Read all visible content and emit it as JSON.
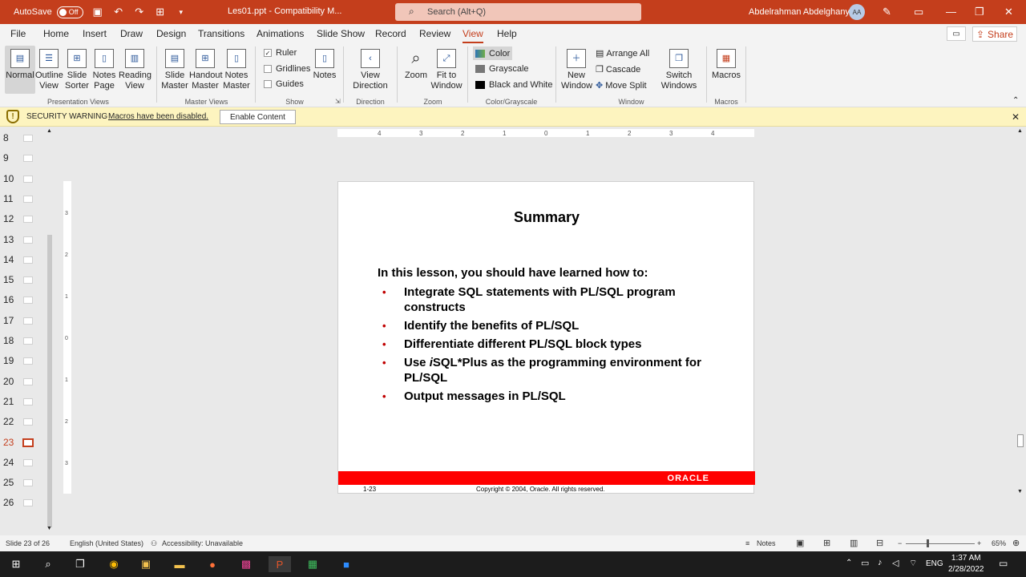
{
  "titlebar": {
    "autosave_label": "AutoSave",
    "autosave_state": "Off",
    "filename": "Les01.ppt - Compatibility M...",
    "search_placeholder": "Search (Alt+Q)",
    "user_name": "Abdelrahman Abdelghany",
    "user_initials": "AA"
  },
  "tabs": [
    "File",
    "Home",
    "Insert",
    "Draw",
    "Design",
    "Transitions",
    "Animations",
    "Slide Show",
    "Record",
    "Review",
    "View",
    "Help"
  ],
  "active_tab": "View",
  "share_label": "Share",
  "ribbon": {
    "presentation_views": {
      "label": "Presentation Views",
      "buttons": [
        "Normal",
        "Outline View",
        "Slide Sorter",
        "Notes Page",
        "Reading View"
      ]
    },
    "master_views": {
      "label": "Master Views",
      "buttons": [
        "Slide Master",
        "Handout Master",
        "Notes Master"
      ]
    },
    "show": {
      "label": "Show",
      "ruler": "Ruler",
      "gridlines": "Gridlines",
      "guides": "Guides",
      "notes": "Notes"
    },
    "direction": {
      "label": "Direction",
      "view_direction": "View Direction"
    },
    "zoom": {
      "label": "Zoom",
      "zoom": "Zoom",
      "fit": "Fit to Window"
    },
    "color": {
      "label": "Color/Grayscale",
      "color": "Color",
      "grayscale": "Grayscale",
      "bw": "Black and White"
    },
    "window": {
      "label": "Window",
      "new_window": "New Window",
      "arrange_all": "Arrange All",
      "cascade": "Cascade",
      "move_split": "Move Split",
      "switch_windows": "Switch Windows"
    },
    "macros": {
      "label": "Macros",
      "macros": "Macros"
    }
  },
  "security": {
    "title": "SECURITY WARNING",
    "message": "Macros have been disabled.",
    "button": "Enable Content"
  },
  "thumbnails": [
    "8",
    "9",
    "10",
    "11",
    "12",
    "13",
    "14",
    "15",
    "16",
    "17",
    "18",
    "19",
    "20",
    "21",
    "22",
    "23",
    "24",
    "25",
    "26"
  ],
  "selected_slide": "23",
  "slide": {
    "title": "Summary",
    "intro": "In this lesson, you should have learned how to:",
    "bullets": [
      "Integrate SQL statements with PL/SQL program constructs",
      "Identify the benefits of PL/SQL",
      "Differentiate different PL/SQL block types",
      "Use iSQL*Plus as the programming environment for PL/SQL",
      "Output messages in PL/SQL"
    ],
    "oracle_logo": "ORACLE",
    "page": "1-23",
    "copyright": "Copyright © 2004, Oracle.  All rights reserved."
  },
  "status": {
    "slide_count": "Slide 23 of 26",
    "language": "English (United States)",
    "accessibility": "Accessibility: Unavailable",
    "notes": "Notes",
    "zoom": "65%"
  },
  "taskbar": {
    "lang": "ENG",
    "time": "1:37 AM",
    "date": "2/28/2022"
  }
}
